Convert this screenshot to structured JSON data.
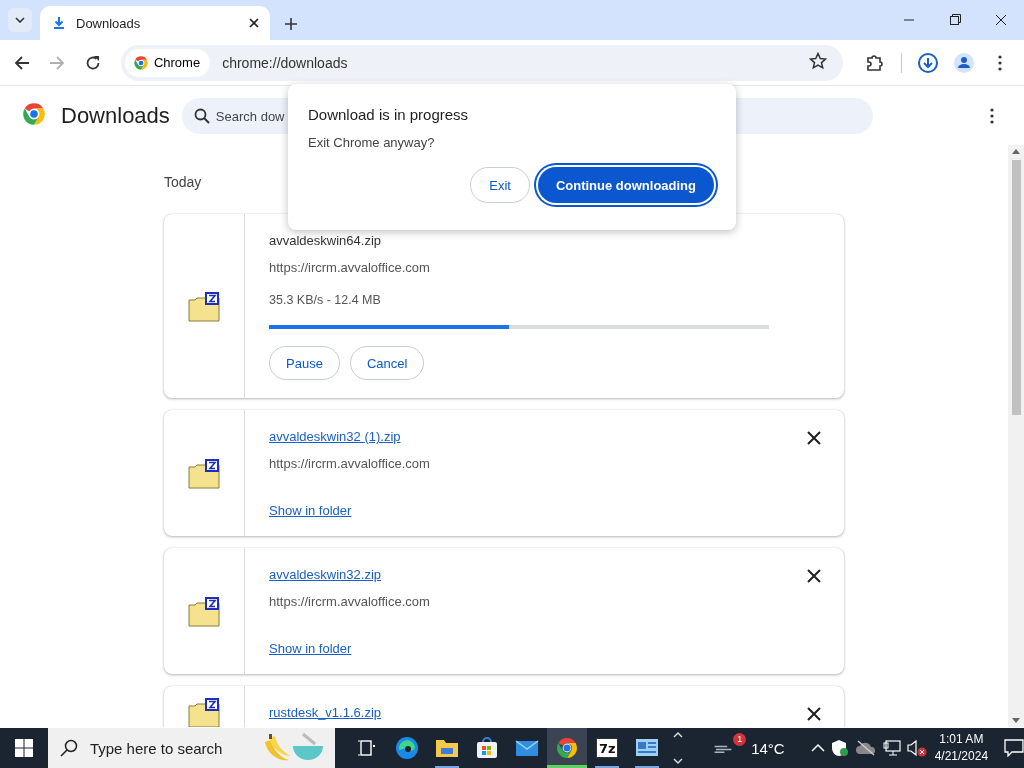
{
  "tab_strip": {
    "tabs": [
      {
        "title": "Downloads",
        "selected": true
      }
    ]
  },
  "toolbar": {
    "back": {
      "disabled": false
    },
    "forward": {
      "disabled": true
    },
    "chip": "Chrome",
    "url": "chrome://downloads"
  },
  "page": {
    "title": "Downloads",
    "search": {
      "placeholder": "Search dow"
    },
    "section": "Today",
    "downloads": [
      {
        "kind": "in_progress",
        "file": "avvaldeskwin64.zip",
        "url": "https://ircrm.avvaloffice.com",
        "status": "35.3 KB/s - 12.4 MB",
        "level": 0.48,
        "actions": [
          "Pause",
          "Cancel"
        ]
      },
      {
        "kind": "complete",
        "file": "avvaldeskwin32 (1).zip",
        "url": "https://ircrm.avvaloffice.com",
        "link": "Show in folder"
      },
      {
        "kind": "complete",
        "file": "avvaldeskwin32.zip",
        "url": "https://ircrm.avvaloffice.com",
        "link": "Show in folder"
      },
      {
        "kind": "complete",
        "file": "rustdesk_v1.1.6.zip"
      }
    ]
  },
  "dialog": {
    "title": "Download is in progress",
    "message": "Exit Chrome anyway?",
    "buttons": [
      {
        "label": "Exit",
        "kind": "secondary"
      },
      {
        "label": "Continue downloading",
        "kind": "primary"
      }
    ]
  },
  "taskbar": {
    "search": {
      "placeholder": "Type here to search"
    },
    "apps": [
      {
        "kind": "task_view",
        "running": false,
        "selected": false
      },
      {
        "kind": "edge",
        "running": false,
        "selected": false
      },
      {
        "kind": "explorer",
        "running": true,
        "selected": false
      },
      {
        "kind": "store",
        "running": false,
        "selected": false
      },
      {
        "kind": "mail",
        "running": false,
        "selected": false
      },
      {
        "kind": "chrome",
        "running": true,
        "selected": true
      },
      {
        "kind": "sevenzip",
        "label": "7z",
        "running": true,
        "selected": false
      },
      {
        "kind": "app",
        "running": true,
        "selected": false
      }
    ],
    "weather": {
      "badge": "1",
      "temperature": "14°C"
    },
    "clock": {
      "time": "1:01 AM",
      "date": "4/21/2024"
    }
  }
}
